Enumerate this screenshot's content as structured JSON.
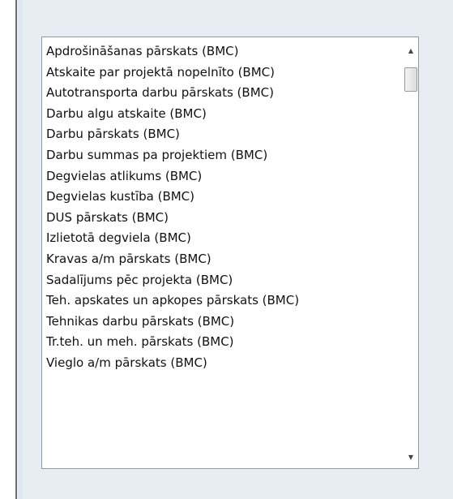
{
  "listbox": {
    "items": [
      "Apdrošināšanas pārskats (BMC)",
      "Atskaite par projektā nopelnīto (BMC)",
      "Autotransporta darbu pārskats (BMC)",
      "Darbu algu atskaite (BMC)",
      "Darbu pārskats (BMC)",
      "Darbu summas pa projektiem (BMC)",
      "Degvielas atlikums (BMC)",
      "Degvielas kustība (BMC)",
      "DUS pārskats (BMC)",
      "Izlietotā degviela (BMC)",
      "Kravas a/m pārskats (BMC)",
      "Sadalījums pēc projekta (BMC)",
      "Teh. apskates un apkopes pārskats (BMC)",
      "Tehnikas darbu pārskats (BMC)",
      "Tr.teh. un meh. pārskats (BMC)",
      "Vieglo a/m pārskats (BMC)"
    ],
    "scroll_up_glyph": "▲",
    "scroll_down_glyph": "▼"
  }
}
